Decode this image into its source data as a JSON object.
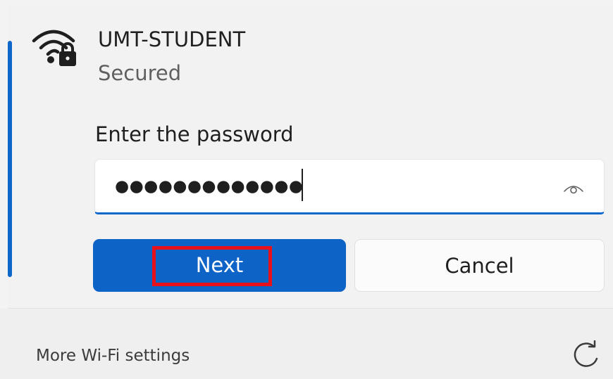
{
  "network": {
    "name": "UMT-STUDENT",
    "status": "Secured"
  },
  "password": {
    "label": "Enter the password",
    "masked_value": "●●●●●●●●●●●●●"
  },
  "buttons": {
    "next_label": "Next",
    "cancel_label": "Cancel"
  },
  "footer": {
    "more_settings_label": "More Wi-Fi settings"
  },
  "icons": {
    "wifi": "wifi-secured-icon",
    "reveal": "eye-icon",
    "refresh": "refresh-icon"
  },
  "colors": {
    "accent": "#0d63c6",
    "highlight": "#e8111b"
  }
}
